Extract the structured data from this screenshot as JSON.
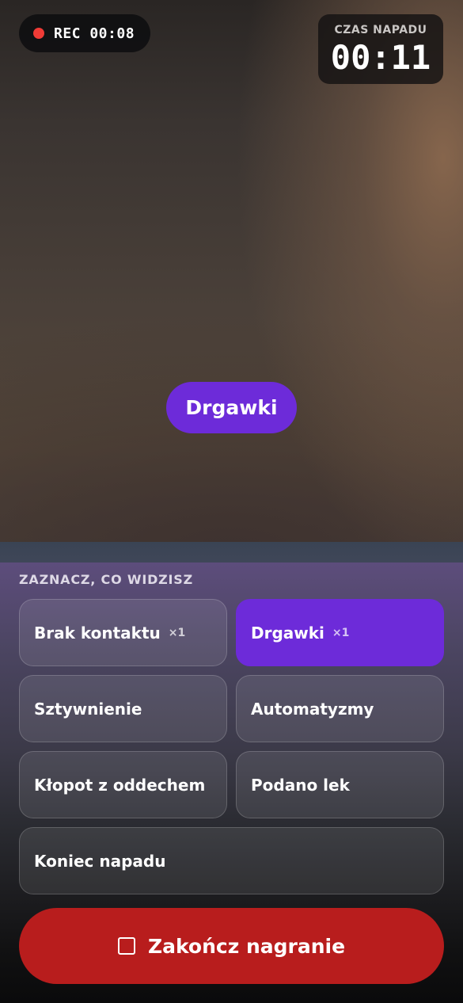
{
  "recording": {
    "label": "REC 00:08"
  },
  "seizure_timer": {
    "title": "CZAS NAPADU",
    "value": "00:11"
  },
  "overlay": {
    "tag": "Drgawki"
  },
  "panel": {
    "title": "ZAZNACZ, CO WIDZISZ",
    "options": [
      {
        "label": "Brak kontaktu",
        "count": "×1",
        "selected": false
      },
      {
        "label": "Drgawki",
        "count": "×1",
        "selected": true
      },
      {
        "label": "Sztywnienie",
        "count": "",
        "selected": false
      },
      {
        "label": "Automatyzmy",
        "count": "",
        "selected": false
      },
      {
        "label": "Kłopot z oddechem",
        "count": "",
        "selected": false
      },
      {
        "label": "Podano lek",
        "count": "",
        "selected": false
      },
      {
        "label": "Koniec napadu",
        "count": "",
        "selected": false
      }
    ]
  },
  "end_button": {
    "label": "Zakończ nagranie"
  },
  "colors": {
    "accent": "#6d2bd9",
    "record": "#ef3b36",
    "stop_button": "#b81d1d"
  },
  "icons": {
    "record": "record-dot-icon",
    "stop": "stop-square-icon"
  }
}
